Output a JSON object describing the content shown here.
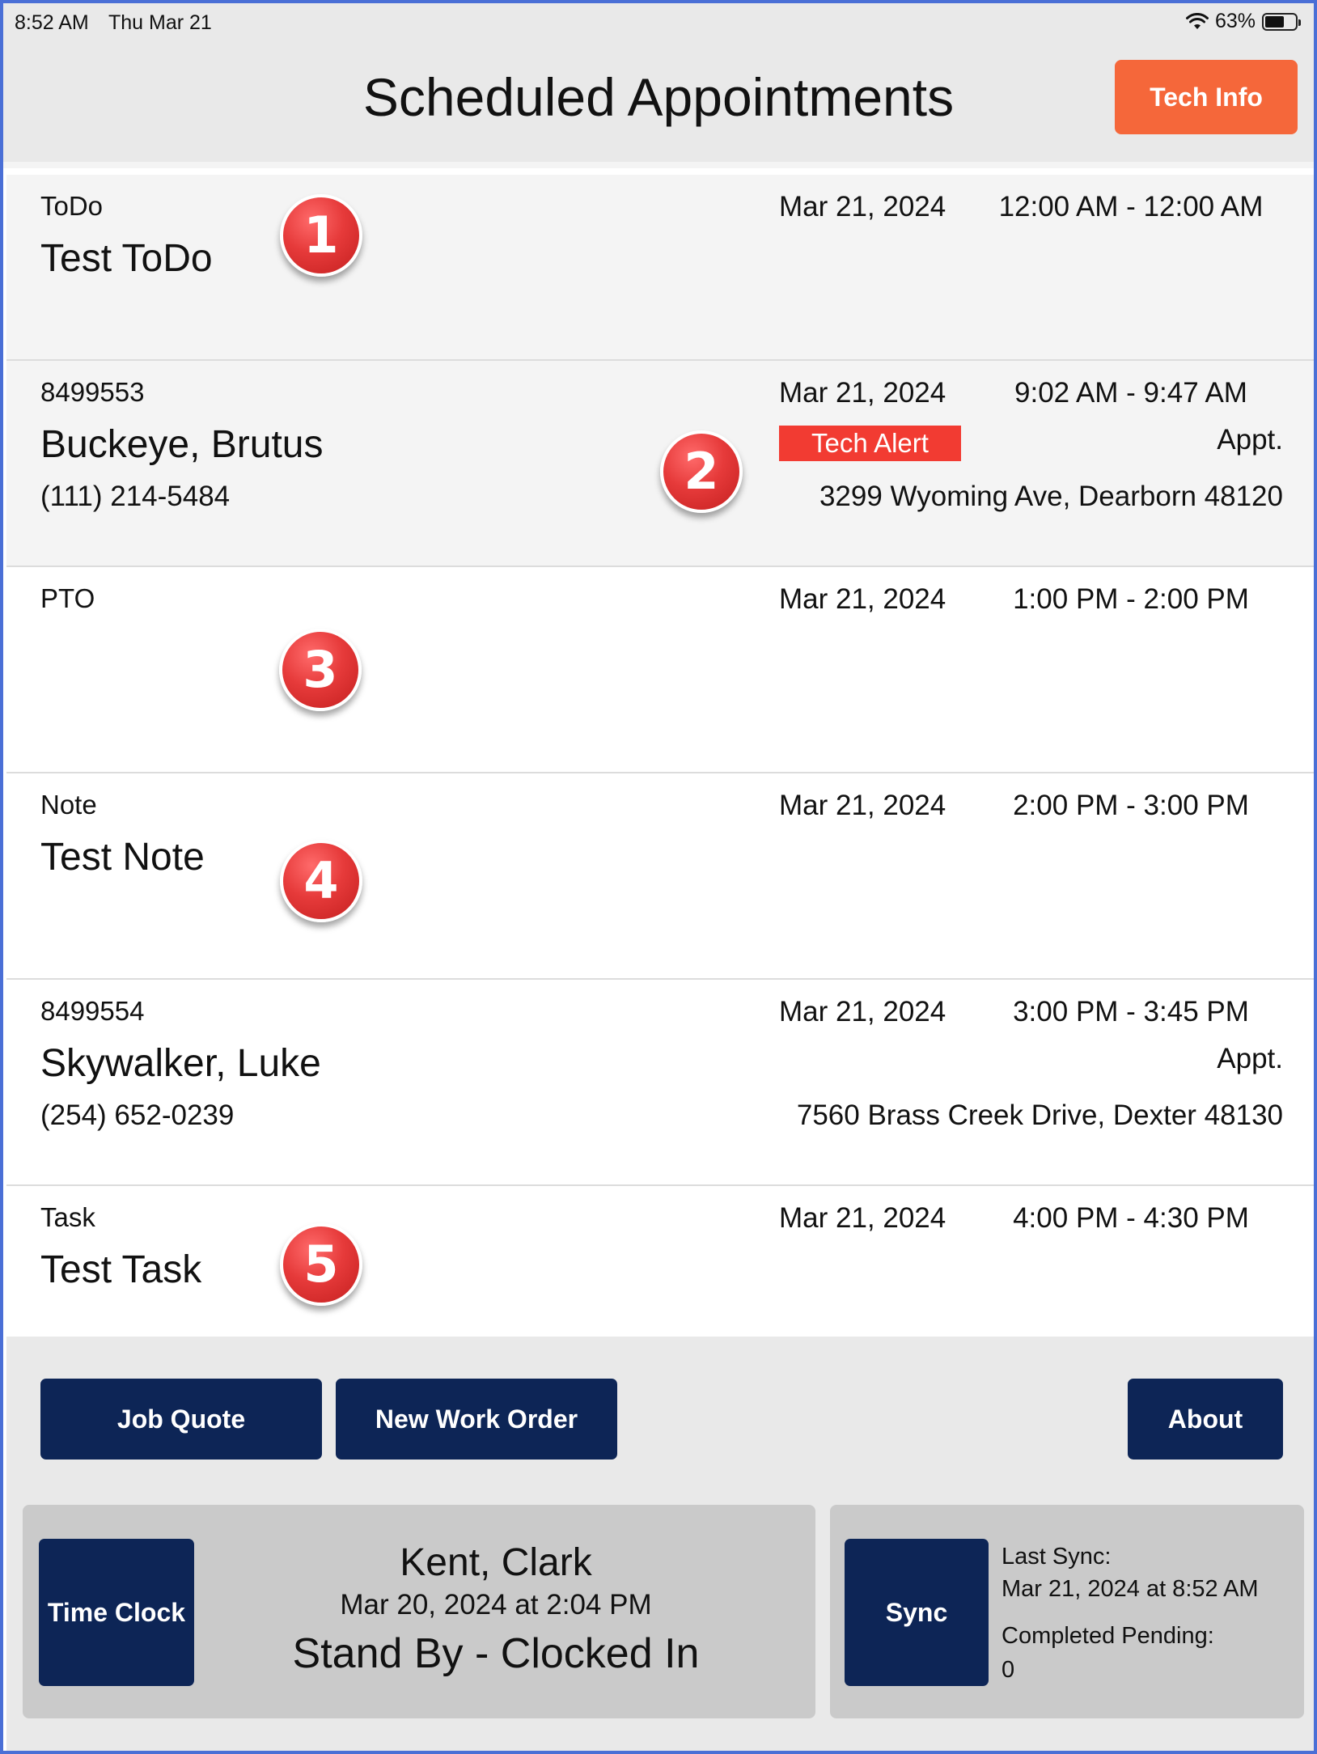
{
  "status_bar": {
    "time": "8:52 AM",
    "date": "Thu Mar 21",
    "battery": "63%",
    "battery_level": 0.63
  },
  "header": {
    "title": "Scheduled Appointments",
    "tech_info_label": "Tech Info"
  },
  "appointments": [
    {
      "type": "ToDo",
      "name": "Test ToDo",
      "date": "Mar 21, 2024",
      "time": "12:00 AM - 12:00 AM",
      "badge": "1"
    },
    {
      "type": "8499553",
      "name": "Buckeye, Brutus",
      "phone": "(111) 214-5484",
      "date": "Mar 21, 2024",
      "time": "9:02 AM - 9:47 AM",
      "alert": "Tech Alert",
      "appt": "Appt.",
      "address": "3299 Wyoming Ave, Dearborn 48120",
      "badge": "2"
    },
    {
      "type": "PTO",
      "date": "Mar 21, 2024",
      "time": "1:00 PM - 2:00 PM",
      "badge": "3"
    },
    {
      "type": "Note",
      "name": "Test Note",
      "date": "Mar 21, 2024",
      "time": "2:00 PM - 3:00 PM",
      "badge": "4"
    },
    {
      "type": "8499554",
      "name": "Skywalker, Luke",
      "phone": "(254) 652-0239",
      "date": "Mar 21, 2024",
      "time": "3:00 PM - 3:45 PM",
      "appt": "Appt.",
      "address": "7560 Brass Creek Drive, Dexter 48130"
    },
    {
      "type": "Task",
      "name": "Test Task",
      "date": "Mar 21, 2024",
      "time": "4:00 PM - 4:30 PM",
      "badge": "5"
    }
  ],
  "footer": {
    "job_quote_label": "Job Quote",
    "new_work_order_label": "New Work Order",
    "about_label": "About",
    "time_clock_label": "Time Clock",
    "tech_name": "Kent, Clark",
    "clock_datetime": "Mar 20, 2024 at 2:04 PM",
    "clock_status": "Stand By - Clocked In",
    "sync_label": "Sync",
    "last_sync_label": "Last Sync:",
    "last_sync_value": "Mar 21, 2024 at 8:52 AM",
    "completed_pending_label": "Completed Pending:",
    "completed_pending_value": "0"
  },
  "colors": {
    "accent_orange": "#f5673a",
    "navy": "#0d2556",
    "alert_red": "#f23b32",
    "badge_red": "#e63a3a",
    "frame_blue": "#4a6fd6"
  }
}
